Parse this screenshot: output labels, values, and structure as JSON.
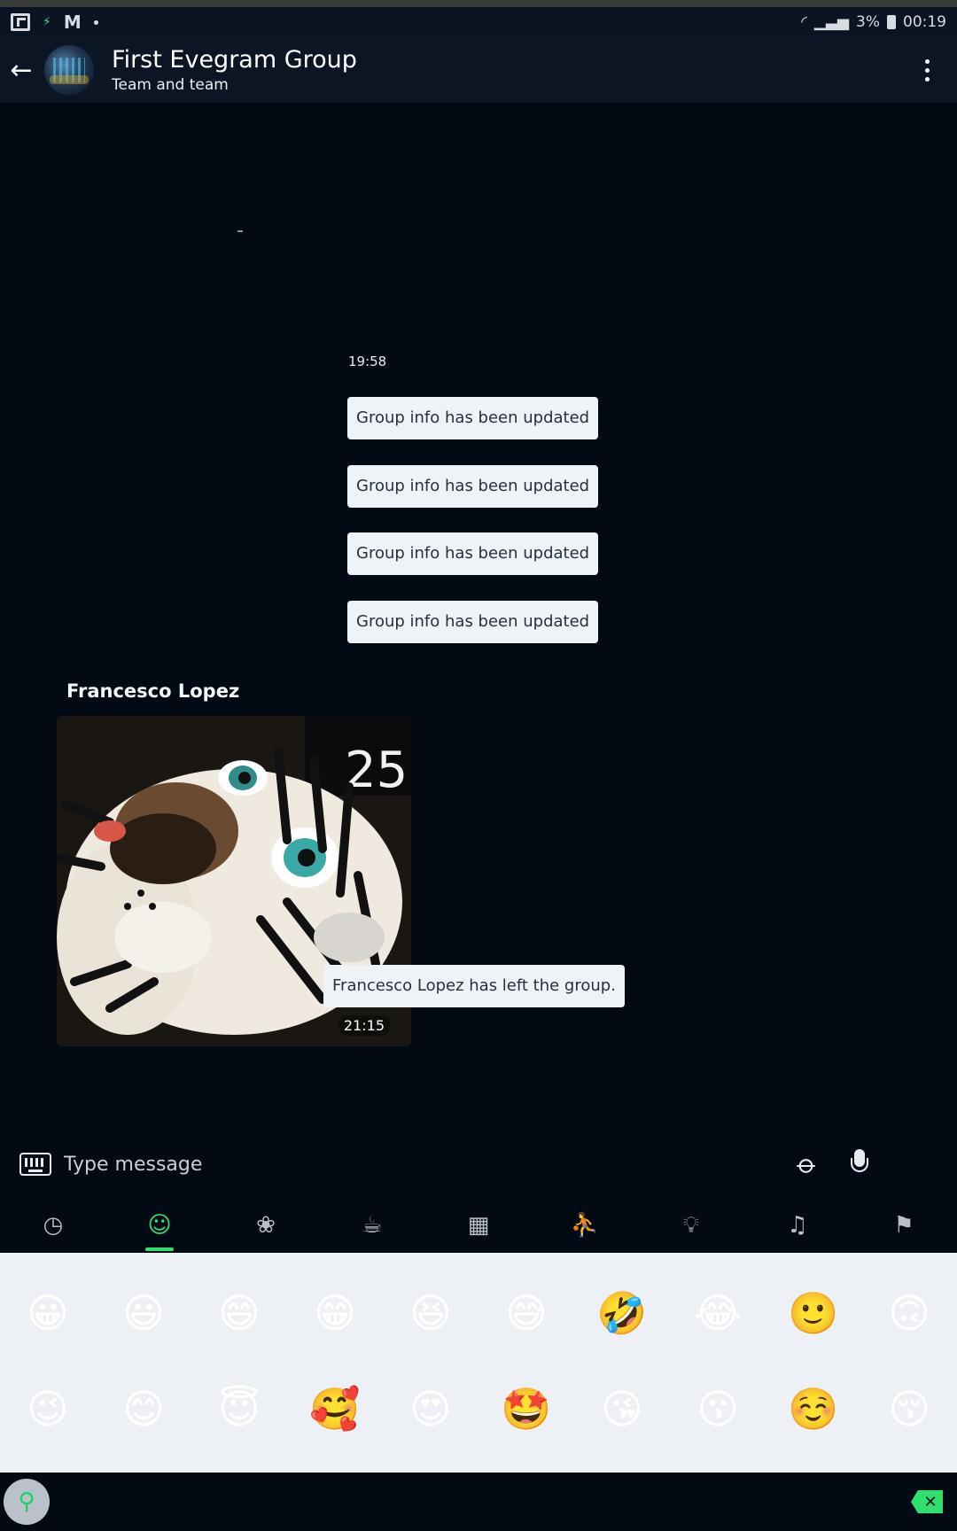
{
  "status_bar": {
    "signal_text": "3%",
    "time": "00:19",
    "icons": [
      "flipboard-icon",
      "spark-icon",
      "gmail-icon",
      "notification-dot",
      "wifi-icon",
      "signal-icon",
      "battery-icon"
    ]
  },
  "header": {
    "title": "First Evegram Group",
    "subtitle": "Team and team"
  },
  "chat": {
    "time_separator": "19:58",
    "system_messages": [
      "Group info has been updated",
      "Group info has been updated",
      "Group info has been updated",
      "Group info has been updated"
    ],
    "photo_message": {
      "sender": "Francesco Lopez",
      "time": "21:15",
      "image_subject": "plush white tiger toy",
      "image_text": "25."
    },
    "left_notice": "Francesco Lopez has left the group."
  },
  "composer": {
    "placeholder": "Type message"
  },
  "emoji_tabs": [
    {
      "icon": "recent-clock-icon",
      "active": false
    },
    {
      "icon": "smiley-icon",
      "active": true
    },
    {
      "icon": "paw-icon",
      "active": false
    },
    {
      "icon": "food-icon",
      "active": false
    },
    {
      "icon": "building-icon",
      "active": false
    },
    {
      "icon": "running-person-icon",
      "active": false
    },
    {
      "icon": "lightbulb-icon",
      "active": false
    },
    {
      "icon": "symbols-icon",
      "active": false
    },
    {
      "icon": "flag-icon",
      "active": false
    }
  ],
  "emoji_rows": [
    [
      "😀",
      "😃",
      "😄",
      "😁",
      "😆",
      "😅",
      "🤣",
      "😂",
      "🙂",
      "🙃"
    ],
    [
      "😉",
      "😊",
      "😇",
      "🥰",
      "😍",
      "🤩",
      "😘",
      "😗",
      "☺️",
      "😚"
    ]
  ],
  "colors": {
    "accent": "#2fe06f",
    "background": "#020a14",
    "header": "#0c1524",
    "system_pill": "#eef3f8"
  }
}
